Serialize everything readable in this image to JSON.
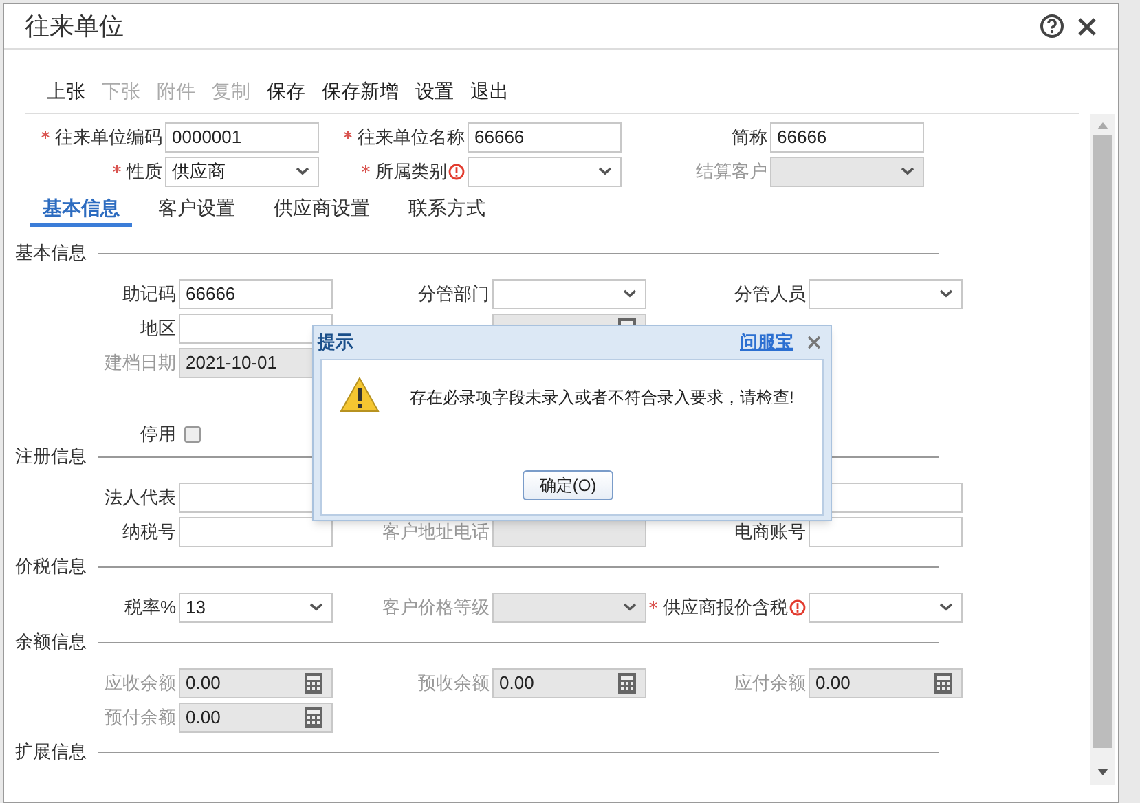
{
  "window": {
    "title": "往来单位"
  },
  "toolbar": [
    {
      "label": "上张",
      "disabled": false
    },
    {
      "label": "下张",
      "disabled": true
    },
    {
      "label": "附件",
      "disabled": true
    },
    {
      "label": "复制",
      "disabled": true
    },
    {
      "label": "保存",
      "disabled": false
    },
    {
      "label": "保存新增",
      "disabled": false
    },
    {
      "label": "设置",
      "disabled": false
    },
    {
      "label": "退出",
      "disabled": false
    }
  ],
  "header_rows": [
    {
      "left": {
        "label": "往来单位编码",
        "required": true,
        "kind": "text",
        "value": "0000001",
        "disabled": false
      },
      "middle": {
        "label": "往来单位名称",
        "required": true,
        "kind": "text",
        "value": "66666",
        "disabled": false
      },
      "right": {
        "label": "简称",
        "kind": "text",
        "value": "66666",
        "disabled": false
      }
    },
    {
      "left": {
        "label": "性质",
        "required": true,
        "kind": "select",
        "value": "供应商",
        "disabled": false
      },
      "middle": {
        "label": "所属类别",
        "required": true,
        "warning": true,
        "kind": "select",
        "disabled": false
      },
      "right": {
        "label": "结算客户",
        "kind": "select",
        "disabled": true
      }
    }
  ],
  "tabs": [
    {
      "label": "基本信息",
      "selected": true
    },
    {
      "label": "客户设置",
      "selected": false
    },
    {
      "label": "供应商设置",
      "selected": false
    },
    {
      "label": "联系方式",
      "selected": false
    }
  ],
  "sections": [
    {
      "title": "基本信息",
      "rows": [
        {
          "left": {
            "label": "助记码",
            "kind": "text",
            "value": "66666",
            "disabled": false
          },
          "middle": {
            "label": "分管部门",
            "kind": "select",
            "disabled": false
          },
          "right": {
            "label": "分管人员",
            "kind": "select",
            "disabled": false
          }
        },
        {
          "left": {
            "label": "地区",
            "kind": "text",
            "disabled": false
          },
          "middle": {
            "kind": "calc",
            "disabled": true
          }
        },
        {
          "left": {
            "label": "建档日期",
            "kind": "date",
            "value": "2021-10-01",
            "disabled": true
          }
        },
        {
          "left": {
            "label": "停用",
            "kind": "checkbox",
            "checked": false
          }
        }
      ]
    },
    {
      "title": "注册信息",
      "rows": [
        {
          "left": {
            "label": "法人代表",
            "kind": "text",
            "disabled": false
          },
          "right": {
            "kind": "text",
            "disabled": false
          }
        },
        {
          "left": {
            "label": "纳税号",
            "kind": "text",
            "disabled": false
          },
          "middle": {
            "label": "客户地址电话",
            "kind": "text",
            "disabled": true
          },
          "right": {
            "label": "电商账号",
            "kind": "text",
            "disabled": false
          }
        }
      ]
    },
    {
      "title": "价税信息",
      "rows": [
        {
          "left": {
            "label": "税率%",
            "kind": "select",
            "value": "13",
            "disabled": false
          },
          "middle": {
            "label": "客户价格等级",
            "kind": "select",
            "disabled": true
          },
          "right": {
            "label": "供应商报价含税",
            "required": true,
            "warning": true,
            "kind": "select",
            "disabled": false
          }
        }
      ]
    },
    {
      "title": "余额信息",
      "rows": [
        {
          "left": {
            "label": "应收余额",
            "kind": "calc",
            "value": "0.00",
            "disabled": true
          },
          "middle": {
            "label": "预收余额",
            "kind": "calc",
            "value": "0.00",
            "disabled": true
          },
          "right": {
            "label": "应付余额",
            "kind": "calc",
            "value": "0.00",
            "disabled": true
          }
        },
        {
          "left": {
            "label": "预付余额",
            "kind": "calc",
            "value": "0.00",
            "disabled": true
          }
        }
      ]
    },
    {
      "title": "扩展信息"
    }
  ],
  "dialog": {
    "title": "提示",
    "link": "问服宝",
    "message": "存在必录项字段未录入或者不符合录入要求，请检查!",
    "button": "确定(O)"
  }
}
